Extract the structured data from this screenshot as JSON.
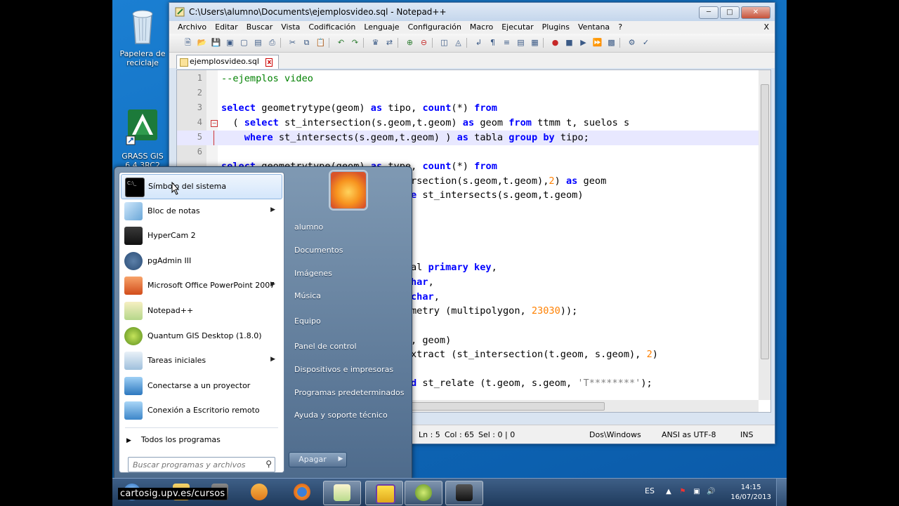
{
  "desktop": {
    "icons": [
      {
        "label_line1": "Papelera de",
        "label_line2": "reciclaje"
      },
      {
        "label_line1": "GRASS GIS",
        "label_line2": "6.4.3RC2"
      }
    ]
  },
  "notepad": {
    "title": "C:\\Users\\alumno\\Documents\\ejemplosvideo.sql - Notepad++",
    "menu": [
      "Archivo",
      "Editar",
      "Buscar",
      "Vista",
      "Codificación",
      "Lenguaje",
      "Configuración",
      "Macro",
      "Ejecutar",
      "Plugins",
      "Ventana",
      "?"
    ],
    "menu_close": "X",
    "tab_label": "ejemplosvideo.sql",
    "tab_close": "x",
    "line_numbers": [
      "1",
      "2",
      "3",
      "4",
      "5",
      "6"
    ],
    "status": {
      "ln": "Ln : 5",
      "col": "Col : 65",
      "sel": "Sel : 0 | 0",
      "eol": "Dos\\Windows",
      "encoding": "ANSI as UTF-8",
      "mode": "INS"
    },
    "colors": {
      "keyword": "#0000ff",
      "comment": "#008000",
      "number": "#ff8000",
      "highlight": "#e8e8ff"
    }
  },
  "code": {
    "l1": "--ejemplos video",
    "l3_kw1": "select",
    "l3_fn": " geometrytype(geom) ",
    "l3_kw2": "as",
    "l3_t1": " tipo, ",
    "l3_kw3": "count",
    "l3_t2": "(*) ",
    "l3_kw4": "from",
    "l4_t0": "  ( ",
    "l4_kw1": "select",
    "l4_t1": " st_intersection(s.geom,t.geom) ",
    "l4_kw2": "as",
    "l4_t2": " geom ",
    "l4_kw3": "from",
    "l4_t3": " ttmm t, suelos s",
    "l5_t0": "    ",
    "l5_kw1": "where",
    "l5_t1": " st_intersects(s.geom,t.geom) ) ",
    "l5_kw2": "as",
    "l5_t2": " tabla ",
    "l5_kw3": "group by",
    "l5_t3": " tipo;",
    "l7_kw1": "select",
    "l7_t1": " geometrytype(geom) ",
    "l7_kw2": "as",
    "l7_t2": " type, ",
    "l7_kw3": "count",
    "l7_t3": "(*) ",
    "l7_kw4": "from",
    "l8_t1": "rsection(s.geom,t.geom),",
    "l8_num": "2",
    "l8_t2": ") ",
    "l8_kw": "as",
    "l8_t3": " geom",
    "l9_kw": "e",
    "l9_t1": " st_intersects(s.geom,t.geom)",
    "l14_t1": "al ",
    "l14_kw": "primary key",
    "l14_t2": ",",
    "l15_kw": "har",
    "l15_t": ",",
    "l16_kw": "char",
    "l16_t": ",",
    "l17_t1": "metry (multipolygon, ",
    "l17_num": "23030",
    "l17_t2": "));",
    "l19_t": ", geom)",
    "l20_t1": "xtract (st_intersection(t.geom, s.geom), ",
    "l20_num": "2",
    "l20_t2": ")",
    "l22_kw": "d",
    "l22_t1": " st_relate (t.geom, s.geom, ",
    "l22_str": "'T********'",
    "l22_t2": ");"
  },
  "startmenu": {
    "left_items": [
      {
        "label": "Símbolo del sistema",
        "submenu": false
      },
      {
        "label": "Bloc de notas",
        "submenu": true
      },
      {
        "label": "HyperCam 2",
        "submenu": false
      },
      {
        "label": "pgAdmin III",
        "submenu": false
      },
      {
        "label": "Microsoft Office PowerPoint 2007",
        "submenu": true
      },
      {
        "label": "Notepad++",
        "submenu": false
      },
      {
        "label": "Quantum GIS Desktop (1.8.0)",
        "submenu": false
      },
      {
        "label": "Tareas iniciales",
        "submenu": true
      },
      {
        "label": "Conectarse a un proyector",
        "submenu": false
      },
      {
        "label": "Conexión a Escritorio remoto",
        "submenu": false
      }
    ],
    "all_programs": "Todos los programas",
    "search_placeholder": "Buscar programas y archivos",
    "right_items": [
      "alumno",
      "Documentos",
      "Imágenes",
      "Música",
      "Equipo",
      "Panel de control",
      "Dispositivos e impresoras",
      "Programas predeterminados",
      "Ayuda y soporte técnico"
    ],
    "shutdown": "Apagar"
  },
  "taskbar": {
    "watermark": "cartosig.upv.es/cursos",
    "language": "ES",
    "time": "14:15",
    "date": "16/07/2013"
  }
}
